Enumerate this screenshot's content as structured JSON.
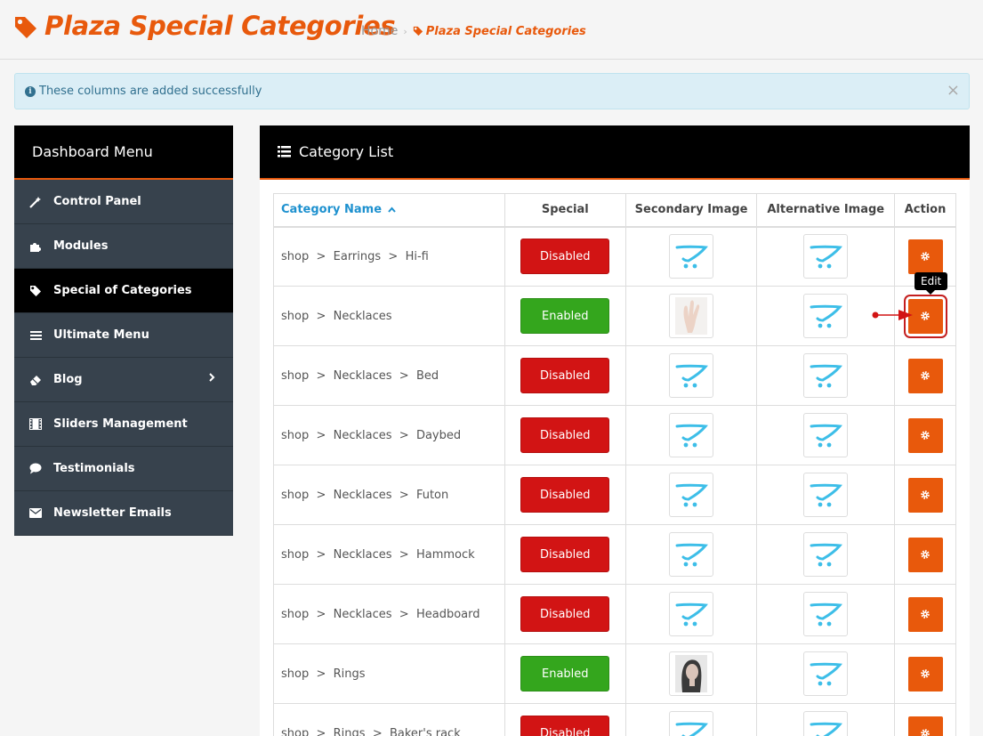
{
  "header": {
    "title": "Plaza Special Categories",
    "breadcrumb_home": "Home",
    "breadcrumb_current": "Plaza Special Categories",
    "accent_color": "#e8590c"
  },
  "alert": {
    "message": "These columns are added successfully",
    "close_label": "×"
  },
  "sidebar": {
    "title": "Dashboard Menu",
    "items": [
      {
        "label": "Control Panel",
        "icon": "magic-wand-icon"
      },
      {
        "label": "Modules",
        "icon": "puzzle-icon"
      },
      {
        "label": "Special of Categories",
        "icon": "tag-icon",
        "active": true
      },
      {
        "label": "Ultimate Menu",
        "icon": "bars-icon"
      },
      {
        "label": "Blog",
        "icon": "eraser-icon",
        "has_submenu": true
      },
      {
        "label": "Sliders Management",
        "icon": "film-icon"
      },
      {
        "label": "Testimonials",
        "icon": "comment-icon"
      },
      {
        "label": "Newsletter Emails",
        "icon": "envelope-icon"
      }
    ]
  },
  "panel": {
    "title": "Category List",
    "columns": [
      "Category Name",
      "Special",
      "Secondary Image",
      "Alternative Image",
      "Action"
    ],
    "sort_indicator": "^",
    "rows": [
      {
        "name": "shop  >  Earrings  >  Hi-fi",
        "special": "Disabled",
        "secondary": "cart",
        "alternative": "cart"
      },
      {
        "name": "shop  >  Necklaces",
        "special": "Enabled",
        "secondary": "hand",
        "alternative": "cart"
      },
      {
        "name": "shop  >  Necklaces  >  Bed",
        "special": "Disabled",
        "secondary": "cart",
        "alternative": "cart"
      },
      {
        "name": "shop  >  Necklaces  >  Daybed",
        "special": "Disabled",
        "secondary": "cart",
        "alternative": "cart"
      },
      {
        "name": "shop  >  Necklaces  >  Futon",
        "special": "Disabled",
        "secondary": "cart",
        "alternative": "cart"
      },
      {
        "name": "shop  >  Necklaces  >  Hammock",
        "special": "Disabled",
        "secondary": "cart",
        "alternative": "cart"
      },
      {
        "name": "shop  >  Necklaces  >  Headboard",
        "special": "Disabled",
        "secondary": "cart",
        "alternative": "cart"
      },
      {
        "name": "shop  >  Rings",
        "special": "Enabled",
        "secondary": "face",
        "alternative": "cart"
      },
      {
        "name": "shop  >  Rings  >  Baker's rack",
        "special": "Disabled",
        "secondary": "cart",
        "alternative": "cart"
      }
    ]
  },
  "tooltip": {
    "label": "Edit"
  },
  "colors": {
    "disabled": "#d21414",
    "enabled": "#34a61d",
    "action": "#e8590c",
    "sidebar_bg": "#37424d"
  }
}
